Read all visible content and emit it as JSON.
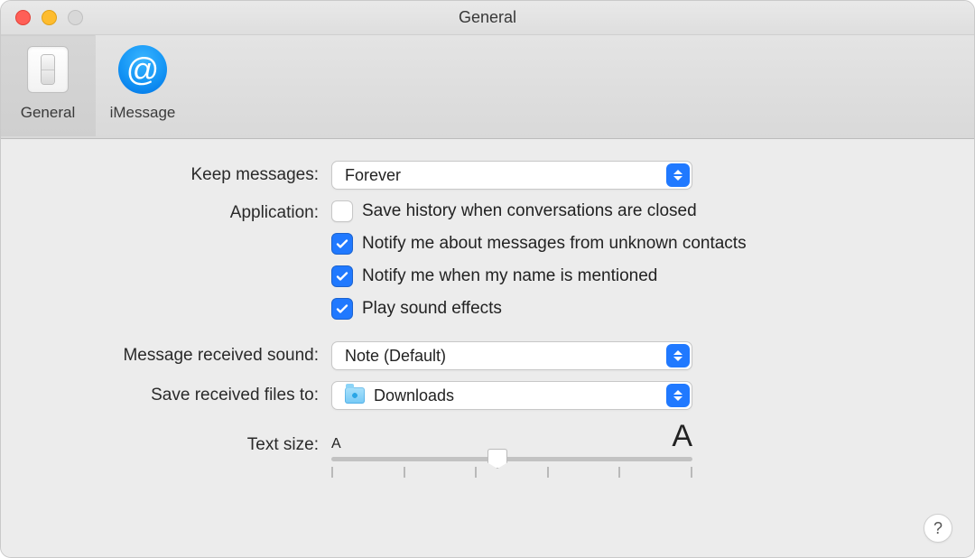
{
  "window": {
    "title": "General"
  },
  "tabs": {
    "general": {
      "label": "General"
    },
    "imessage": {
      "label": "iMessage",
      "glyph": "@"
    }
  },
  "form": {
    "keep_messages": {
      "label": "Keep messages:",
      "value": "Forever"
    },
    "application": {
      "label": "Application:",
      "save_history": {
        "label": "Save history when conversations are closed",
        "checked": false
      },
      "notify_unknown": {
        "label": "Notify me about messages from unknown contacts",
        "checked": true
      },
      "notify_name": {
        "label": "Notify me when my name is mentioned",
        "checked": true
      },
      "play_sound": {
        "label": "Play sound effects",
        "checked": true
      }
    },
    "received_sound": {
      "label": "Message received sound:",
      "value": "Note (Default)"
    },
    "save_files": {
      "label": "Save received files to:",
      "value": "Downloads"
    },
    "text_size": {
      "label": "Text size:",
      "small_glyph": "A",
      "big_glyph": "A"
    }
  },
  "help": {
    "glyph": "?"
  }
}
